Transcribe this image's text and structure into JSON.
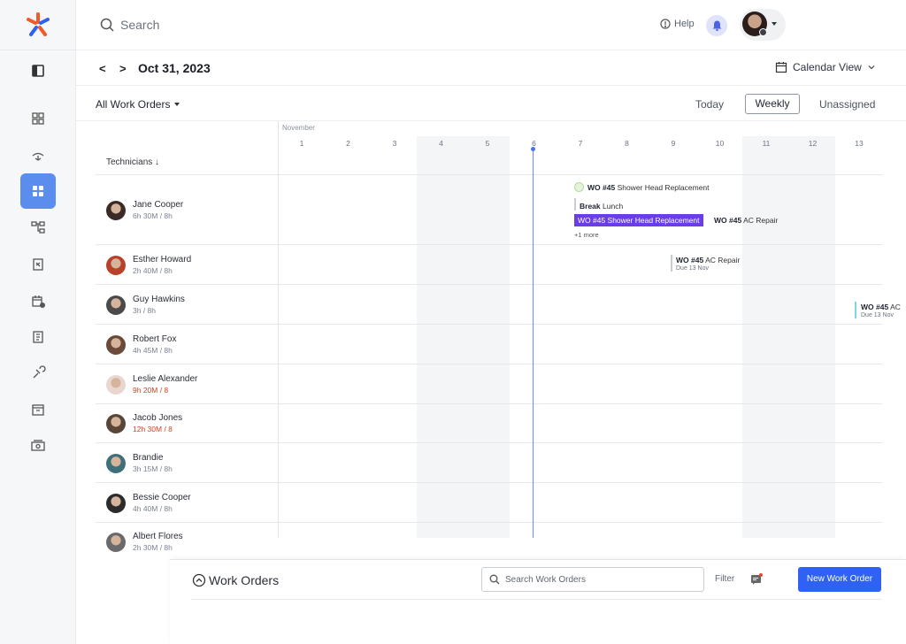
{
  "search": {
    "placeholder": "Search"
  },
  "header": {
    "help_label": "Help"
  },
  "datebar": {
    "prev": "<",
    "next": ">",
    "date": "Oct 31, 2023",
    "view_label": "Calendar View"
  },
  "filters": {
    "work_orders_filter": "All Work Orders",
    "today": "Today",
    "weekly": "Weekly",
    "unassigned": "Unassigned"
  },
  "calendar": {
    "month": "November",
    "days": [
      "1",
      "2",
      "3",
      "4",
      "5",
      "6",
      "7",
      "8",
      "9",
      "10",
      "11",
      "12",
      "13"
    ],
    "technicians_header": "Technicians ↓"
  },
  "technicians": [
    {
      "name": "Jane Cooper",
      "hours": "6h 30M / 8h",
      "over": false,
      "color": "#3b2a26"
    },
    {
      "name": "Esther Howard",
      "hours": "2h 40M / 8h",
      "over": false,
      "color": "#b8412a"
    },
    {
      "name": "Guy Hawkins",
      "hours": "3h / 8h",
      "over": false,
      "color": "#4a4a4a"
    },
    {
      "name": "Robert Fox",
      "hours": "4h 45M / 8h",
      "over": false,
      "color": "#6b4a3a"
    },
    {
      "name": "Leslie Alexander",
      "hours": "9h 20M / 8",
      "over": true,
      "color": "#e9d6d0"
    },
    {
      "name": "Jacob Jones",
      "hours": "12h 30M / 8",
      "over": true,
      "color": "#5a4638"
    },
    {
      "name": "Brandie",
      "hours": "3h 15M / 8h",
      "over": false,
      "color": "#3f6f78"
    },
    {
      "name": "Bessie Cooper",
      "hours": "4h 40M / 8h",
      "over": false,
      "color": "#2b2b2b"
    },
    {
      "name": "Albert Flores",
      "hours": "2h 30M / 8h",
      "over": false,
      "color": "#6a6a6a"
    }
  ],
  "events": {
    "e1_id": "WO #45",
    "e1_title": "Shower Head Replacement",
    "e2_id": "Break",
    "e2_title": "Lunch",
    "e3_label": "WO #45 Shower Head Replacement",
    "e4_id": "WO #45",
    "e4_title": "AC Repair",
    "more": "+1 more",
    "e5_id": "WO #45",
    "e5_title": "AC Repair",
    "e5_due": "Due 13 Nov",
    "e6_id": "WO #45",
    "e6_title": "AC",
    "e6_due": "Due 13 Nov"
  },
  "work_orders_panel": {
    "title": "Work Orders",
    "search_placeholder": "Search Work Orders",
    "filter": "Filter",
    "new_button": "New Work Order"
  },
  "colors": {
    "accent": "#5b8def",
    "primary_button": "#2f62f3",
    "event_chip": "#6a3de8",
    "today_line": "#6b8cf2",
    "over_hours": "#d6401f"
  }
}
